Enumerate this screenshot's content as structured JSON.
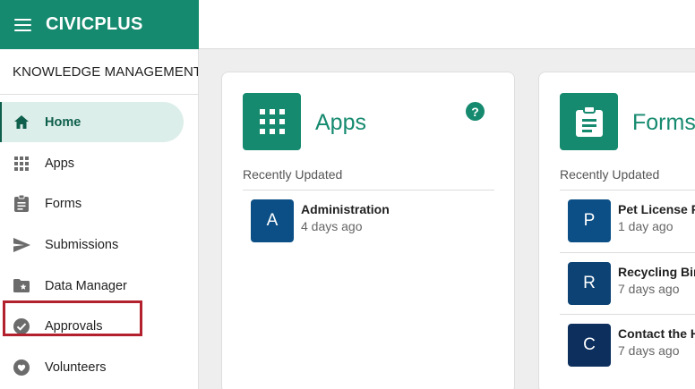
{
  "header": {
    "brand": "CIVICPLUS"
  },
  "sidebar": {
    "site_name": "KNOWLEDGE MANAGEMENT",
    "site_chevron": "›",
    "items": [
      {
        "label": "Home",
        "icon": "home-icon",
        "active": true
      },
      {
        "label": "Apps",
        "icon": "apps-grid-icon"
      },
      {
        "label": "Forms",
        "icon": "clipboard-icon"
      },
      {
        "label": "Submissions",
        "icon": "send-icon"
      },
      {
        "label": "Data Manager",
        "icon": "folder-star-icon"
      },
      {
        "label": "Approvals",
        "icon": "check-circle-icon"
      },
      {
        "label": "Volunteers",
        "icon": "heart-hands-icon",
        "highlighted": true
      }
    ]
  },
  "apps_card": {
    "title": "Apps",
    "help": "?",
    "section": "Recently Updated",
    "items": [
      {
        "initial": "A",
        "title": "Administration",
        "updated": "4 days ago",
        "color": "#0b4f86"
      }
    ]
  },
  "forms_card": {
    "title": "Forms",
    "section": "Recently Updated",
    "items": [
      {
        "initial": "P",
        "title": "Pet License Re",
        "updated": "1 day ago",
        "color": "#0b4f86"
      },
      {
        "initial": "R",
        "title": "Recycling Bin",
        "updated": "7 days ago",
        "color": "#0c4274"
      },
      {
        "initial": "C",
        "title": "Contact the He",
        "updated": "7 days ago",
        "color": "#0c2f5e"
      }
    ]
  },
  "colors": {
    "brand": "#168a6f",
    "active_bg": "#dceee9",
    "highlight": "#b3202e"
  }
}
